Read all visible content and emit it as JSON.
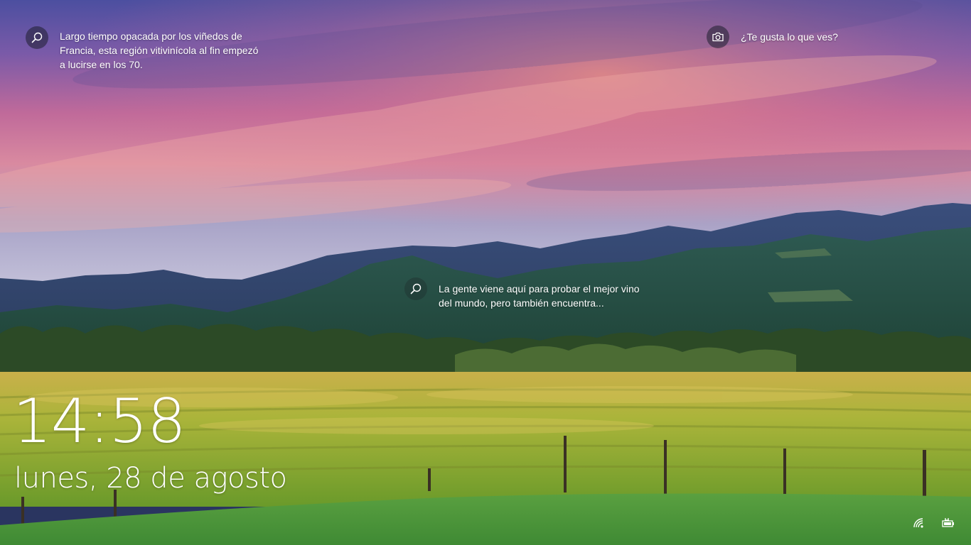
{
  "spotlight": {
    "left_fact": "Largo tiempo opacada por los viñedos de Francia, esta región vitivinícola al fin empezó a lucirse en los 70.",
    "feedback_prompt": "¿Te gusta lo que ves?",
    "center_fact": "La gente viene aquí para probar el mejor vino del mundo, pero también encuentra..."
  },
  "clock": {
    "time": "14:58",
    "date": "lunes, 28 de agosto"
  },
  "icons": {
    "left_fact": "search-icon",
    "feedback": "camera-icon",
    "center_fact": "search-icon",
    "network": "wifi-icon",
    "power": "battery-icon"
  },
  "colors": {
    "sky_top": "#4a5aa8",
    "sky_glow": "#e07a8e",
    "mountains": "#2a4a6a",
    "vineyard": "#b8b438",
    "grass": "#4a9a3a"
  }
}
